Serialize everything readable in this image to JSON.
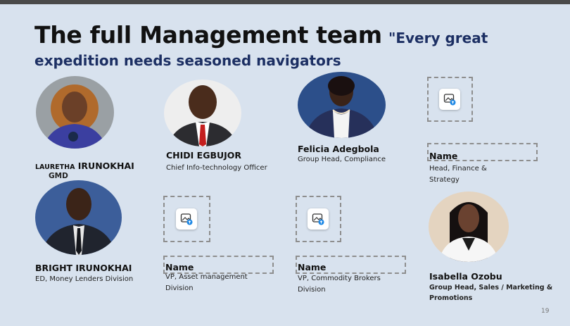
{
  "title": {
    "main": "The full Management team",
    "quote_start": "\"Every great",
    "quote_end": "expedition needs seasoned navigators"
  },
  "members": {
    "lauretha": {
      "name_prefix": "LAURETHA",
      "name_rest": "IRUNOKHAI",
      "role": "GMD"
    },
    "chidi": {
      "name": "CHIDI EGBUJOR",
      "role": "Chief Info-technology Officer"
    },
    "felicia": {
      "name": "Felicia Adegbola",
      "role": "Group Head, Compliance"
    },
    "finance": {
      "name": "Name",
      "role_line1": "Head, Finance &",
      "role_line2": "Strategy"
    },
    "bright": {
      "name": "BRIGHT IRUNOKHAI",
      "role": "ED, Money Lenders Division"
    },
    "asset": {
      "name": "Name",
      "role_line1": "VP, Asset management",
      "role_line2": "Division"
    },
    "commodity": {
      "name": "Name",
      "role_line1": "VP, Commodity Brokers",
      "role_line2": "Division"
    },
    "isabella": {
      "name": "Isabella Ozobu",
      "role_line1": "Group Head, Sales / Marketing &",
      "role_line2": "Promotions"
    }
  },
  "icons": {
    "placeholder": "image-upload-icon"
  },
  "colors": {
    "background": "#d8e2ee",
    "title": "#111111",
    "quote": "#1c2f63",
    "upload_accent": "#1e88e5"
  },
  "page_number": "19"
}
